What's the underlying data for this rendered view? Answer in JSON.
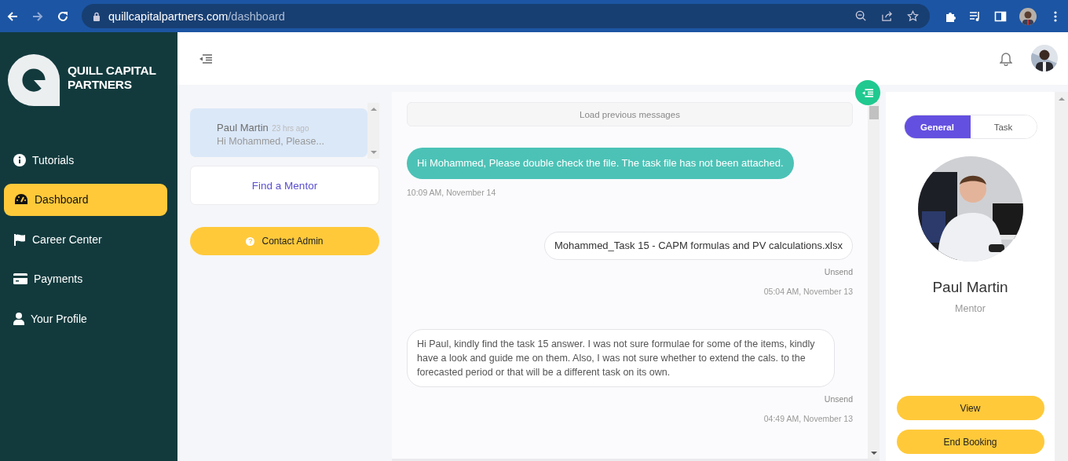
{
  "browser": {
    "url_host": "quillcapitalpartners.com",
    "url_path": "/dashboard"
  },
  "sidebar": {
    "logo_lines": [
      "QUILL CAPITAL",
      "PARTNERS"
    ],
    "items": [
      {
        "label": "Tutorials",
        "kind": "info",
        "selected": false
      },
      {
        "label": "Dashboard",
        "kind": "gauge",
        "selected": true
      },
      {
        "label": "Career Center",
        "kind": "flag",
        "selected": false
      },
      {
        "label": "Payments",
        "kind": "card",
        "selected": false
      },
      {
        "label": "Your Profile",
        "kind": "user",
        "selected": false
      }
    ]
  },
  "conversations": [
    {
      "name": "Paul Martin",
      "time": "23 hrs ago",
      "preview": "Hi Mohammed, Please...",
      "selected": true
    }
  ],
  "find_mentor": "Find a Mentor",
  "contact_admin": {
    "icon": "?",
    "label": "Contact Admin"
  },
  "chat": {
    "load_previous": "Load previous messages",
    "messages": [
      {
        "kind": "received",
        "text": "Hi Mohammed, Please double check the file. The task file has not been attached.",
        "time": "10:09 AM, November 14"
      },
      {
        "kind": "sent",
        "text": "Mohammed_Task 15 - CAPM formulas and PV calculations.xlsx",
        "status": "Unsend",
        "time": "05:04 AM, November 13"
      },
      {
        "kind": "sent",
        "text": "Hi Paul, kindly find the task 15 answer. I was not sure formulae for some of the items, kindly have a look and guide me on them. Also, I was not sure whether to extend the cals. to the forecasted period or that will be a different task on its own.",
        "status": "Unsend",
        "time": "04:49 AM, November 13"
      }
    ]
  },
  "profile": {
    "tabs": [
      {
        "label": "General",
        "selected": true
      },
      {
        "label": "Task",
        "selected": false
      }
    ],
    "name": "Paul Martin",
    "role": "Mentor",
    "buttons": [
      "View",
      "End Booking"
    ]
  }
}
